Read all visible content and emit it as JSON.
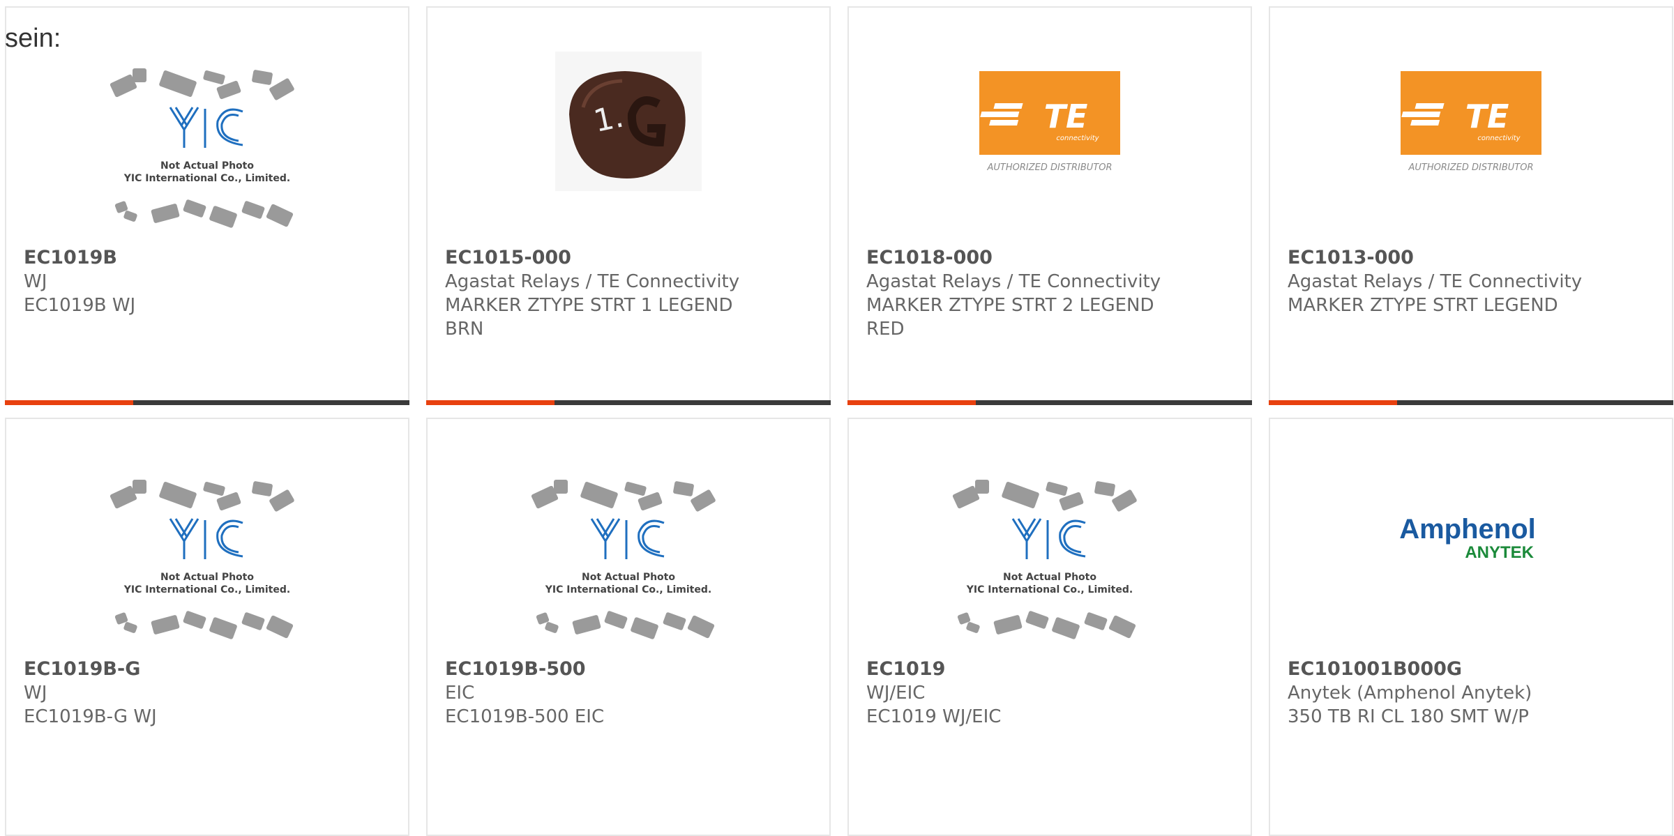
{
  "intro_text": "sein:",
  "products": [
    {
      "part": "EC1019B",
      "maker": "WJ",
      "desc": "EC1019B WJ",
      "image": "yic-not-actual-photo",
      "photo_caption": [
        "Not Actual Photo",
        "YIC International Co., Limited."
      ]
    },
    {
      "part": "EC1015-000",
      "maker": "Agastat Relays / TE Connectivity",
      "desc": "MARKER ZTYPE STRT 1 LEGEND BRN",
      "image": "brown-cable-marker",
      "marker_glyph": "1."
    },
    {
      "part": "EC1018-000",
      "maker": "Agastat Relays / TE Connectivity",
      "desc": "MARKER ZTYPE STRT 2 LEGEND RED",
      "image": "te-logo",
      "logo": {
        "brand": "TE",
        "sub": "connectivity",
        "tagline": "AUTHORIZED DISTRIBUTOR"
      }
    },
    {
      "part": "EC1013-000",
      "maker": "Agastat Relays / TE Connectivity",
      "desc": "MARKER ZTYPE STRT LEGEND",
      "image": "te-logo",
      "logo": {
        "brand": "TE",
        "sub": "connectivity",
        "tagline": "AUTHORIZED DISTRIBUTOR"
      }
    },
    {
      "part": "EC1019B-G",
      "maker": "WJ",
      "desc": "EC1019B-G WJ",
      "image": "yic-not-actual-photo",
      "photo_caption": [
        "Not Actual Photo",
        "YIC International Co., Limited."
      ]
    },
    {
      "part": "EC1019B-500",
      "maker": "EIC",
      "desc": "EC1019B-500 EIC",
      "image": "yic-not-actual-photo",
      "photo_caption": [
        "Not Actual Photo",
        "YIC International Co., Limited."
      ]
    },
    {
      "part": "EC1019",
      "maker": "WJ/EIC",
      "desc": "EC1019 WJ/EIC",
      "image": "yic-not-actual-photo",
      "photo_caption": [
        "Not Actual Photo",
        "YIC International Co., Limited."
      ]
    },
    {
      "part": "EC101001B000G",
      "maker": "Anytek (Amphenol Anytek)",
      "desc": "350 TB RI CL 180 SMT W/P",
      "image": "amphenol-logo",
      "logo": {
        "brand": "Amphenol",
        "sub": "ANYTEK"
      }
    }
  ],
  "colors": {
    "accent": "#e8410f",
    "bar": "#3a3a3a",
    "te_orange": "#f39325",
    "amphenol_blue": "#1a5aa0",
    "anytek_green": "#1b8a3a",
    "yic_blue": "#1f6fbf"
  }
}
